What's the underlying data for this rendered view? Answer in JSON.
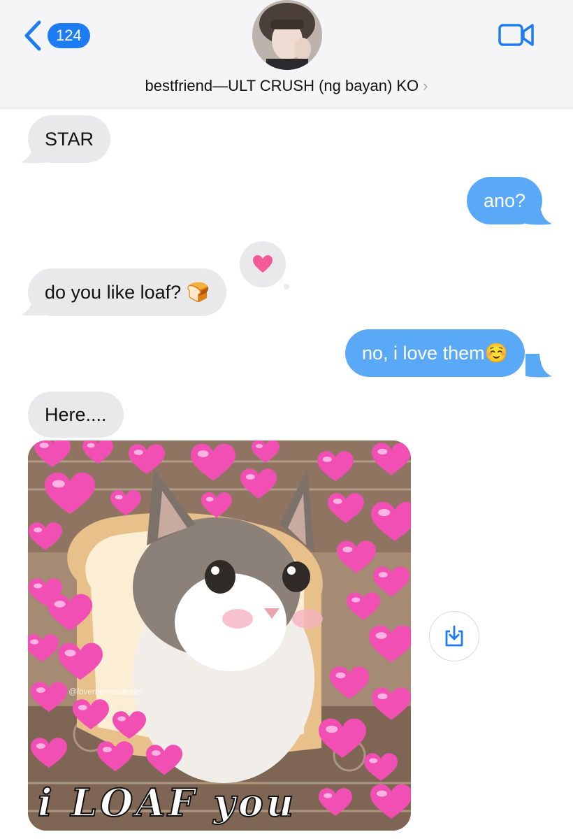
{
  "header": {
    "back_count": "124",
    "contact_name": "bestfriend—ULT CRUSH (ng bayan) KO",
    "chevron": "›",
    "back_icon": "chevron-left-icon",
    "video_icon": "video-camera-icon"
  },
  "messages": [
    {
      "direction": "received",
      "text": "STAR"
    },
    {
      "direction": "sent",
      "text": "ano?"
    },
    {
      "direction": "received",
      "text": "do you like loaf? 🍞",
      "tapback": "heart"
    },
    {
      "direction": "sent",
      "text": "no, i love them☺️"
    },
    {
      "direction": "received",
      "text": "Here...."
    },
    {
      "direction": "received",
      "type": "image",
      "image_caption": "i LOAF you",
      "watermark": "@lovememesdealer"
    }
  ],
  "colors": {
    "accent": "#1d7cf2",
    "sent_bubble": "#5aa9f7",
    "received_bubble": "#e9e9eb",
    "tapback_heart": "#f25b98"
  }
}
